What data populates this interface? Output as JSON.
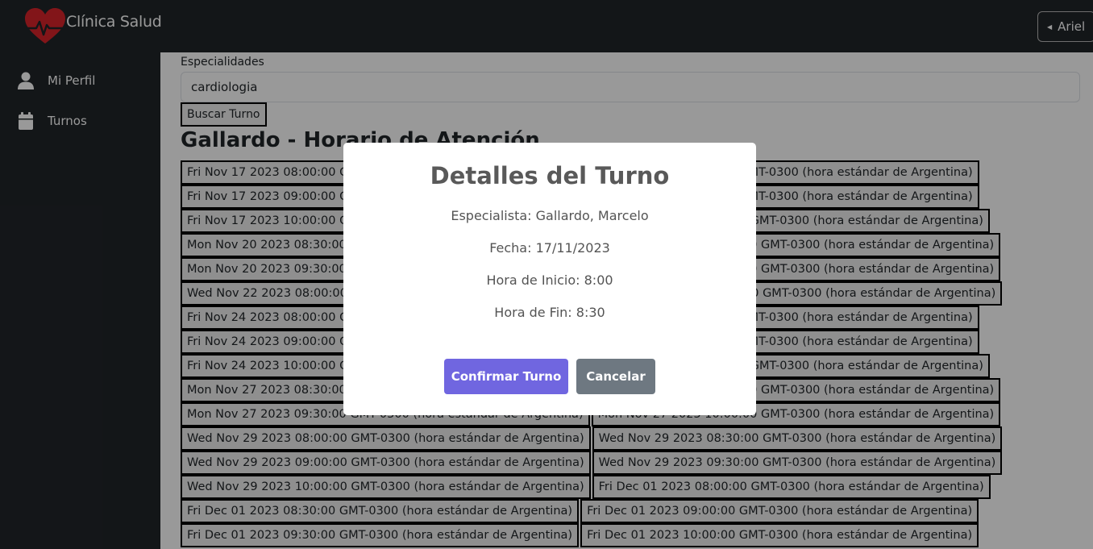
{
  "header": {
    "brand": "Clínica Salud",
    "user_label": "Ariel"
  },
  "sidebar": {
    "items": [
      {
        "label": "Mi Perfil",
        "icon": "user-icon"
      },
      {
        "label": "Turnos",
        "icon": "calendar-icon"
      }
    ]
  },
  "main": {
    "specialty_label": "Especialidades",
    "specialty_value": "cardiologia",
    "search_button": "Buscar Turno",
    "title": "Gallardo - Horario de Atención",
    "slots": [
      [
        "Fri Nov 17 2023 08:00:00 GMT-0300 (hora estándar de Argentina)",
        "Fri Nov 17 2023 08:30:00 GMT-0300 (hora estándar de Argentina)"
      ],
      [
        "Fri Nov 17 2023 09:00:00 GMT-0300 (hora estándar de Argentina)",
        "Fri Nov 17 2023 09:30:00 GMT-0300 (hora estándar de Argentina)"
      ],
      [
        "Fri Nov 17 2023 10:00:00 GMT-0300 (hora estándar de Argentina)",
        "Mon Nov 20 2023 08:00:00 GMT-0300 (hora estándar de Argentina)"
      ],
      [
        "Mon Nov 20 2023 08:30:00 GMT-0300 (hora estándar de Argentina)",
        "Mon Nov 20 2023 09:00:00 GMT-0300 (hora estándar de Argentina)"
      ],
      [
        "Mon Nov 20 2023 09:30:00 GMT-0300 (hora estándar de Argentina)",
        "Mon Nov 20 2023 10:00:00 GMT-0300 (hora estándar de Argentina)"
      ],
      [
        "Wed Nov 22 2023 08:00:00 GMT-0300 (hora estándar de Argentina)",
        "Wed Nov 22 2023 08:30:00 GMT-0300 (hora estándar de Argentina)"
      ],
      [
        "Fri Nov 24 2023 08:00:00 GMT-0300 (hora estándar de Argentina)",
        "Fri Nov 24 2023 08:30:00 GMT-0300 (hora estándar de Argentina)"
      ],
      [
        "Fri Nov 24 2023 09:00:00 GMT-0300 (hora estándar de Argentina)",
        "Fri Nov 24 2023 09:30:00 GMT-0300 (hora estándar de Argentina)"
      ],
      [
        "Fri Nov 24 2023 10:00:00 GMT-0300 (hora estándar de Argentina)",
        "Mon Nov 27 2023 08:00:00 GMT-0300 (hora estándar de Argentina)"
      ],
      [
        "Mon Nov 27 2023 08:30:00 GMT-0300 (hora estándar de Argentina)",
        "Mon Nov 27 2023 09:00:00 GMT-0300 (hora estándar de Argentina)"
      ],
      [
        "Mon Nov 27 2023 09:30:00 GMT-0300 (hora estándar de Argentina)",
        "Mon Nov 27 2023 10:00:00 GMT-0300 (hora estándar de Argentina)"
      ],
      [
        "Wed Nov 29 2023 08:00:00 GMT-0300 (hora estándar de Argentina)",
        "Wed Nov 29 2023 08:30:00 GMT-0300 (hora estándar de Argentina)"
      ],
      [
        "Wed Nov 29 2023 09:00:00 GMT-0300 (hora estándar de Argentina)",
        "Wed Nov 29 2023 09:30:00 GMT-0300 (hora estándar de Argentina)"
      ],
      [
        "Wed Nov 29 2023 10:00:00 GMT-0300 (hora estándar de Argentina)",
        "Fri Dec 01 2023 08:00:00 GMT-0300 (hora estándar de Argentina)"
      ],
      [
        "Fri Dec 01 2023 08:30:00 GMT-0300 (hora estándar de Argentina)",
        "Fri Dec 01 2023 09:00:00 GMT-0300 (hora estándar de Argentina)"
      ],
      [
        "Fri Dec 01 2023 09:30:00 GMT-0300 (hora estándar de Argentina)",
        "Fri Dec 01 2023 10:00:00 GMT-0300 (hora estándar de Argentina)"
      ]
    ]
  },
  "modal": {
    "title": "Detalles del Turno",
    "specialist": "Especialista: Gallardo, Marcelo",
    "date": "Fecha: 17/11/2023",
    "start": "Hora de Inicio: 8:00",
    "end": "Hora de Fin: 8:30",
    "confirm_label": "Confirmar Turno",
    "cancel_label": "Cancelar"
  },
  "colors": {
    "navbar": "#212529",
    "heart": "#d9242b",
    "confirm": "#7066e0",
    "cancel": "#6e7881"
  }
}
